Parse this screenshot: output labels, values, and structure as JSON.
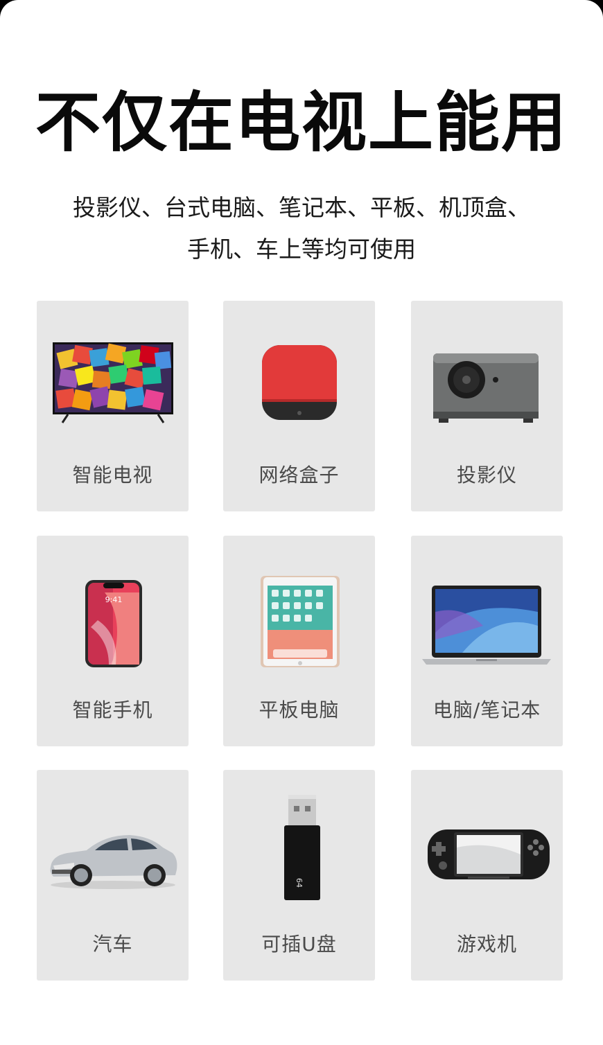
{
  "header": {
    "title": "不仅在电视上能用",
    "subtitle_line1": "投影仪、台式电脑、笔记本、平板、机顶盒、",
    "subtitle_line2": "手机、车上等均可使用"
  },
  "devices": [
    {
      "label": "智能电视",
      "icon": "tv-icon"
    },
    {
      "label": "网络盒子",
      "icon": "set-top-box-icon"
    },
    {
      "label": "投影仪",
      "icon": "projector-icon"
    },
    {
      "label": "智能手机",
      "icon": "smartphone-icon"
    },
    {
      "label": "平板电脑",
      "icon": "tablet-icon"
    },
    {
      "label": "电脑/笔记本",
      "icon": "laptop-icon"
    },
    {
      "label": "汽车",
      "icon": "car-icon"
    },
    {
      "label": "可插U盘",
      "icon": "usb-drive-icon"
    },
    {
      "label": "游戏机",
      "icon": "handheld-console-icon"
    }
  ],
  "art_text": {
    "phone_time": "9:41",
    "usb_capacity": "64"
  }
}
